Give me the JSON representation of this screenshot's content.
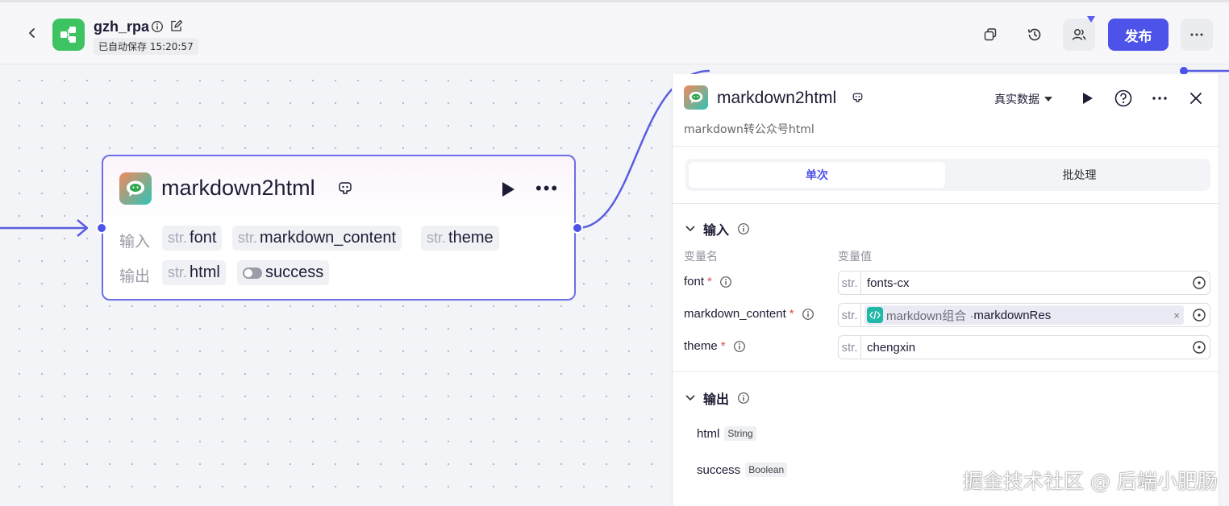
{
  "header": {
    "app_name": "gzh_rpa",
    "saved_status": "已自动保存 15:20:57",
    "publish_label": "发布"
  },
  "node": {
    "title": "markdown2html",
    "input_label": "输入",
    "output_label": "输出",
    "inputs": [
      {
        "type": "str.",
        "name": "font"
      },
      {
        "type": "str.",
        "name": "markdown_content"
      },
      {
        "type": "str.",
        "name": "theme"
      }
    ],
    "outputs": [
      {
        "type": "str.",
        "name": "html"
      },
      {
        "type": "toggle",
        "name": "success"
      }
    ]
  },
  "panel": {
    "title": "markdown2html",
    "data_mode": "真实数据",
    "description": "markdown转公众号html",
    "tabs": [
      {
        "label": "单次",
        "active": true
      },
      {
        "label": "批处理",
        "active": false
      }
    ],
    "input_section": {
      "title": "输入",
      "col_name": "变量名",
      "col_value": "变量值",
      "fields": [
        {
          "name": "font",
          "required_mark": "*",
          "type": "str.",
          "value": "fonts-cx"
        },
        {
          "name": "markdown_content",
          "required_mark": "*",
          "type": "str.",
          "ref_source": "markdown组合 · ",
          "ref_var": "markdownRes",
          "clear": "×"
        },
        {
          "name": "theme",
          "required_mark": "*",
          "type": "str.",
          "value": "chengxin"
        }
      ]
    },
    "output_section": {
      "title": "输出",
      "items": [
        {
          "name": "html",
          "type": "String"
        },
        {
          "name": "success",
          "type": "Boolean"
        }
      ]
    }
  },
  "watermark": "掘金技术社区 @ 后端小肥肠",
  "colors": {
    "accent": "#4d53e8",
    "app_green": "#3ec363",
    "required": "#e54a4a"
  }
}
